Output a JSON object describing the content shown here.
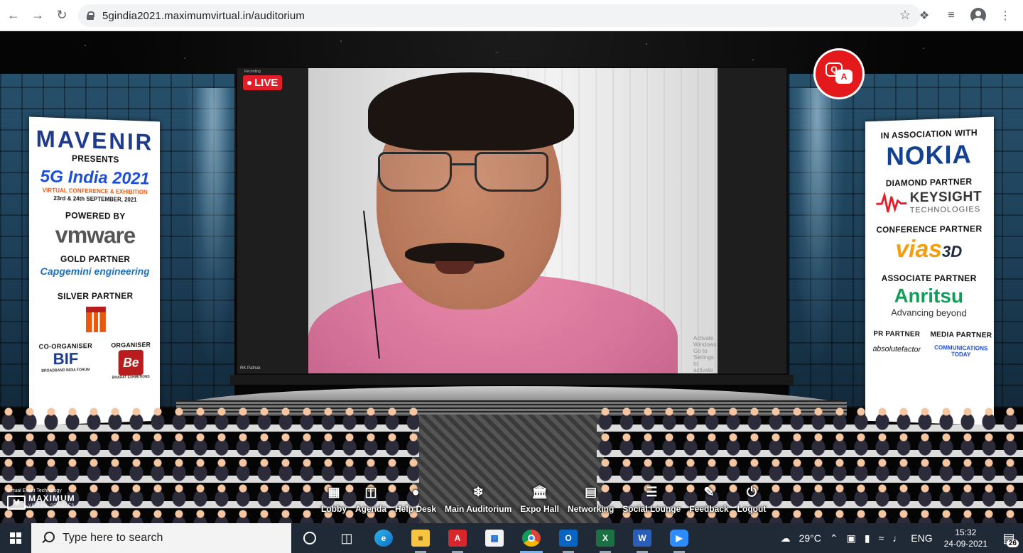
{
  "browser": {
    "url": "5gindia2021.maximumvirtual.in/auditorium"
  },
  "screen": {
    "live_label": "LIVE",
    "recording_label": "Recording",
    "speaker_name": "RK Pathak",
    "watermark_line1": "Activate Windows",
    "watermark_line2": "Go to Settings to activate Windows."
  },
  "banner_left": {
    "brand": "MAVENIR",
    "presents": "PRESENTS",
    "event": "5G India 2021",
    "event_sub": "VIRTUAL CONFERENCE & EXHIBITION",
    "event_date": "23rd & 24th SEPTEMBER, 2021",
    "powered_by": "POWERED BY",
    "powered_logo": "vmware",
    "gold": "GOLD PARTNER",
    "gold_logo": "Capgemini engineering",
    "silver": "SILVER PARTNER",
    "co_organiser": "CO-ORGANISER",
    "co_organiser_logo": "BIF",
    "co_organiser_sub": "BROADBAND INDIA FORUM",
    "organiser": "ORGANISER",
    "organiser_logo": "Be",
    "organiser_sub": "BHARAT EXHIBITIONS"
  },
  "banner_right": {
    "association": "IN ASSOCIATION WITH",
    "association_logo": "NOKIA",
    "diamond": "DIAMOND PARTNER",
    "diamond_logo_1": "KEYSIGHT",
    "diamond_logo_2": "TECHNOLOGIES",
    "conference": "CONFERENCE PARTNER",
    "conference_logo": "vias",
    "conference_logo_suffix": "3D",
    "associate": "ASSOCIATE PARTNER",
    "associate_logo": "Anritsu",
    "associate_sub": "Advancing beyond",
    "pr": "PR PARTNER",
    "pr_logo": "absolutefactor",
    "media": "MEDIA PARTNER",
    "media_logo": "COMMUNICATIONS TODAY"
  },
  "qa": {
    "q": "Q",
    "a": "A"
  },
  "brand": {
    "tagline": "Virtual Event Technology",
    "name": "MAXIMUM",
    "sub": "VIRTUAL SERVICES"
  },
  "nav": [
    {
      "label": "Lobby",
      "icon": "grid-icon"
    },
    {
      "label": "Agenda",
      "icon": "calendar-icon"
    },
    {
      "label": "Help Desk",
      "icon": "chat-icon"
    },
    {
      "label": "Main Auditorium",
      "icon": "snowflake-icon"
    },
    {
      "label": "Expo Hall",
      "icon": "building-icon"
    },
    {
      "label": "Networking",
      "icon": "window-icon"
    },
    {
      "label": "Social Lounge",
      "icon": "database-icon"
    },
    {
      "label": "Feedback",
      "icon": "edit-icon"
    },
    {
      "label": "Logout",
      "icon": "power-icon"
    }
  ],
  "taskbar": {
    "search_placeholder": "Type here to search",
    "temperature": "29°C",
    "language": "ENG",
    "time": "15:32",
    "date": "24-09-2021",
    "notifications": "26"
  }
}
